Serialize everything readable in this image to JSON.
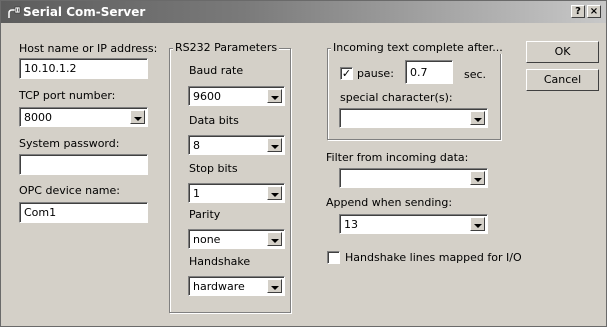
{
  "window": {
    "title": "Serial Com-Server",
    "help_label": "?",
    "close_label": "×"
  },
  "host": {
    "label": "Host name or IP address:",
    "value": "10.10.1.2"
  },
  "tcp": {
    "label": "TCP port number:",
    "value": "8000"
  },
  "password": {
    "label": "System password:",
    "value": ""
  },
  "opc": {
    "label": "OPC device name:",
    "value": "Com1"
  },
  "rs232": {
    "title": "RS232 Parameters",
    "baud": {
      "label": "Baud rate",
      "value": "9600"
    },
    "databits": {
      "label": "Data bits",
      "value": "8"
    },
    "stopbits": {
      "label": "Stop bits",
      "value": "1"
    },
    "parity": {
      "label": "Parity",
      "value": "none"
    },
    "handshake": {
      "label": "Handshake",
      "value": "hardware"
    }
  },
  "incoming": {
    "title": "Incoming text complete after...",
    "pause_label": "pause:",
    "pause_checked": true,
    "pause_value": "0.7",
    "unit": "sec.",
    "special_label": "special character(s):",
    "special_value": ""
  },
  "filter": {
    "label": "Filter from incoming data:",
    "value": ""
  },
  "append": {
    "label": "Append when sending:",
    "value": "13"
  },
  "handshake_io": {
    "label": "Handshake lines mapped for I/O",
    "checked": false
  },
  "buttons": {
    "ok": "OK",
    "cancel": "Cancel"
  },
  "icons": {
    "app": "serial-plug-icon",
    "checkmark": "✓"
  }
}
